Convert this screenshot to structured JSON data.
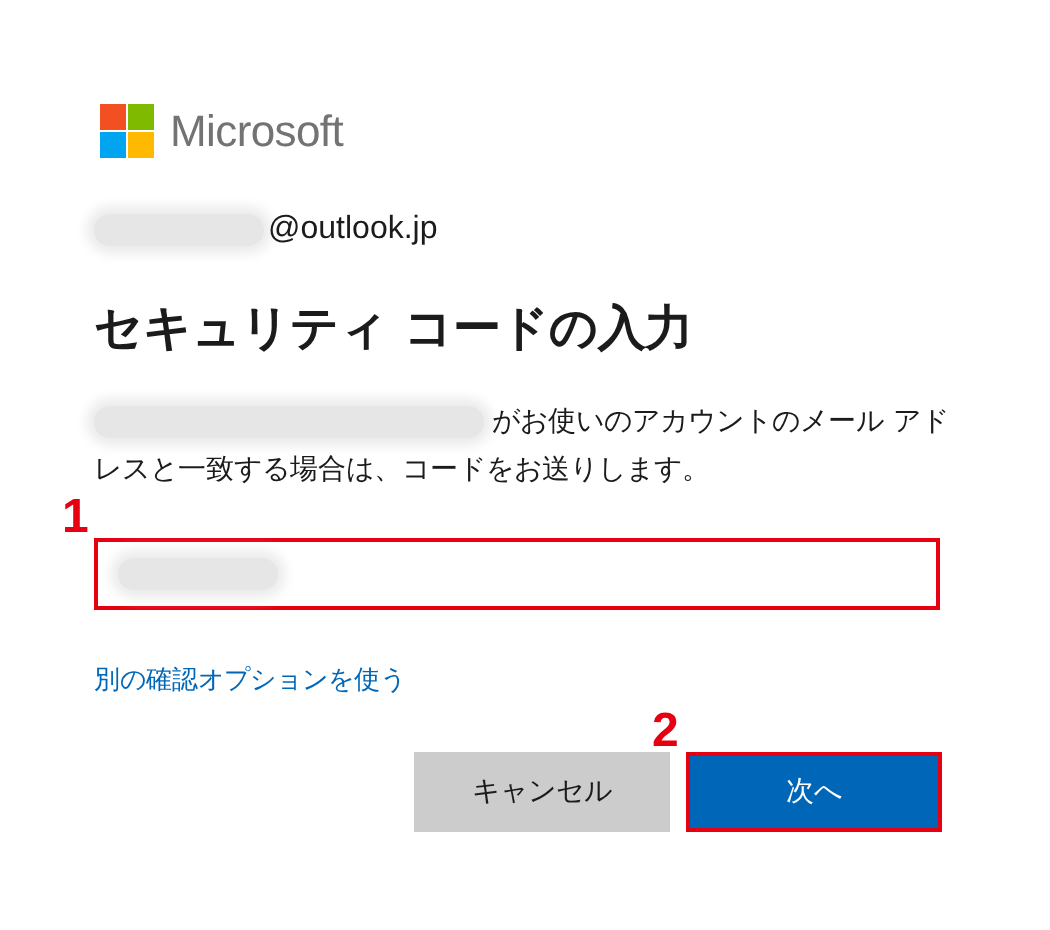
{
  "logo": {
    "text": "Microsoft"
  },
  "account": {
    "redacted_prefix": true,
    "domain": "@outlook.jp"
  },
  "title": "セキュリティ コードの入力",
  "description": {
    "redacted_prefix": true,
    "lines": [
      "がお使いのアカウントのメール アド",
      "レスと一致する場合は、コードをお送りします。"
    ]
  },
  "code_field": {
    "value_redacted": true,
    "highlighted": true,
    "marker": "1"
  },
  "link": "別の確認オプションを使う",
  "buttons": [
    {
      "label": "キャンセル",
      "kind": "secondary",
      "highlighted": false
    },
    {
      "label": "次へ",
      "kind": "primary",
      "highlighted": true,
      "marker": "2"
    }
  ]
}
